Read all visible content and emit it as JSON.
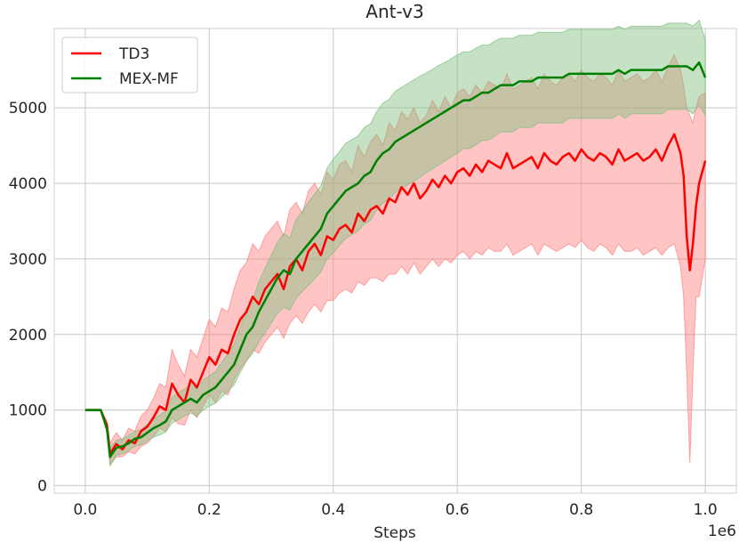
{
  "chart_data": {
    "type": "line",
    "title": "Ant-v3",
    "xlabel": "Steps",
    "ylabel": "",
    "x_scale_label": "1e6",
    "xlim": [
      -0.05,
      1.05
    ],
    "ylim": [
      -100,
      6050
    ],
    "xticks": [
      0.0,
      0.2,
      0.4,
      0.6,
      0.8,
      1.0
    ],
    "xtick_labels": [
      "0.0",
      "0.2",
      "0.4",
      "0.6",
      "0.8",
      "1.0"
    ],
    "yticks": [
      0,
      1000,
      2000,
      3000,
      4000,
      5000
    ],
    "ytick_labels": [
      "0",
      "1000",
      "2000",
      "3000",
      "4000",
      "5000"
    ],
    "grid": true,
    "legend_position": "top-left",
    "series": [
      {
        "name": "TD3",
        "color": "#ff0000",
        "band_color": "#ff7f7f",
        "x": [
          0.0,
          0.025,
          0.035,
          0.04,
          0.05,
          0.06,
          0.07,
          0.08,
          0.09,
          0.1,
          0.11,
          0.12,
          0.13,
          0.14,
          0.15,
          0.16,
          0.17,
          0.18,
          0.19,
          0.2,
          0.21,
          0.22,
          0.23,
          0.24,
          0.25,
          0.26,
          0.27,
          0.28,
          0.29,
          0.3,
          0.31,
          0.32,
          0.33,
          0.34,
          0.35,
          0.36,
          0.37,
          0.38,
          0.39,
          0.4,
          0.41,
          0.42,
          0.43,
          0.44,
          0.45,
          0.46,
          0.47,
          0.48,
          0.49,
          0.5,
          0.51,
          0.52,
          0.53,
          0.54,
          0.55,
          0.56,
          0.57,
          0.58,
          0.59,
          0.6,
          0.61,
          0.62,
          0.63,
          0.64,
          0.65,
          0.66,
          0.67,
          0.68,
          0.69,
          0.7,
          0.71,
          0.72,
          0.73,
          0.74,
          0.75,
          0.76,
          0.77,
          0.78,
          0.79,
          0.8,
          0.81,
          0.82,
          0.83,
          0.84,
          0.85,
          0.86,
          0.87,
          0.88,
          0.89,
          0.9,
          0.91,
          0.92,
          0.93,
          0.94,
          0.95,
          0.96,
          0.965,
          0.97,
          0.975,
          0.98,
          0.985,
          0.99,
          1.0
        ],
        "y": [
          1000,
          1000,
          800,
          420,
          550,
          480,
          600,
          560,
          720,
          780,
          900,
          1050,
          1000,
          1350,
          1200,
          1100,
          1400,
          1300,
          1500,
          1700,
          1600,
          1800,
          1750,
          2000,
          2200,
          2300,
          2500,
          2400,
          2600,
          2700,
          2800,
          2600,
          2900,
          3000,
          2850,
          3100,
          3200,
          3050,
          3300,
          3250,
          3400,
          3450,
          3350,
          3600,
          3500,
          3650,
          3700,
          3600,
          3800,
          3750,
          3950,
          3850,
          4000,
          3800,
          3900,
          4050,
          3950,
          4100,
          4000,
          4150,
          4200,
          4100,
          4250,
          4150,
          4300,
          4250,
          4200,
          4400,
          4200,
          4250,
          4300,
          4350,
          4200,
          4400,
          4300,
          4250,
          4350,
          4400,
          4300,
          4450,
          4350,
          4300,
          4400,
          4350,
          4250,
          4450,
          4300,
          4350,
          4400,
          4300,
          4350,
          4450,
          4300,
          4500,
          4650,
          4400,
          4100,
          3300,
          2850,
          3200,
          3700,
          4000,
          4300
        ],
        "lower": [
          1000,
          1000,
          750,
          280,
          380,
          380,
          450,
          420,
          520,
          560,
          650,
          760,
          720,
          900,
          820,
          800,
          1000,
          900,
          1050,
          1200,
          1100,
          1250,
          1200,
          1400,
          1550,
          1650,
          1800,
          1750,
          1900,
          2000,
          2100,
          1950,
          2150,
          2250,
          2150,
          2300,
          2400,
          2300,
          2450,
          2450,
          2550,
          2600,
          2550,
          2700,
          2650,
          2750,
          2750,
          2700,
          2800,
          2800,
          2900,
          2800,
          2950,
          2800,
          2900,
          3000,
          2900,
          3000,
          2950,
          3050,
          3100,
          3000,
          3100,
          3050,
          3150,
          3100,
          3100,
          3200,
          3050,
          3100,
          3150,
          3200,
          3050,
          3200,
          3150,
          3100,
          3150,
          3200,
          3150,
          3250,
          3150,
          3100,
          3200,
          3150,
          3050,
          3200,
          3100,
          3100,
          3150,
          3050,
          3100,
          3150,
          3050,
          3150,
          3200,
          2900,
          2500,
          1500,
          300,
          1500,
          2500,
          2500,
          3000
        ],
        "upper": [
          1000,
          1000,
          850,
          560,
          700,
          600,
          760,
          720,
          920,
          1000,
          1150,
          1350,
          1300,
          1800,
          1600,
          1450,
          1800,
          1700,
          1950,
          2200,
          2100,
          2350,
          2300,
          2600,
          2850,
          2950,
          3200,
          3100,
          3300,
          3400,
          3500,
          3300,
          3650,
          3750,
          3600,
          3900,
          4000,
          3850,
          4150,
          4050,
          4250,
          4300,
          4150,
          4500,
          4350,
          4550,
          4650,
          4500,
          4800,
          4700,
          4950,
          4850,
          5000,
          4800,
          4900,
          5100,
          4950,
          5150,
          5000,
          5200,
          5250,
          5150,
          5300,
          5200,
          5350,
          5300,
          5250,
          5450,
          5250,
          5300,
          5350,
          5400,
          5250,
          5450,
          5350,
          5300,
          5400,
          5450,
          5350,
          5500,
          5400,
          5350,
          5450,
          5400,
          5300,
          5500,
          5350,
          5400,
          5450,
          5350,
          5400,
          5500,
          5350,
          5550,
          5700,
          5500,
          5300,
          5000,
          4900,
          4800,
          5000,
          5150,
          5200
        ]
      },
      {
        "name": "MEX-MF",
        "color": "#008000",
        "band_color": "#7fbf7f",
        "x": [
          0.0,
          0.025,
          0.035,
          0.04,
          0.05,
          0.06,
          0.07,
          0.08,
          0.09,
          0.1,
          0.11,
          0.12,
          0.13,
          0.14,
          0.15,
          0.16,
          0.17,
          0.18,
          0.19,
          0.2,
          0.21,
          0.22,
          0.23,
          0.24,
          0.25,
          0.26,
          0.27,
          0.28,
          0.29,
          0.3,
          0.31,
          0.32,
          0.33,
          0.34,
          0.35,
          0.36,
          0.37,
          0.38,
          0.39,
          0.4,
          0.41,
          0.42,
          0.43,
          0.44,
          0.45,
          0.46,
          0.47,
          0.48,
          0.49,
          0.5,
          0.51,
          0.52,
          0.53,
          0.54,
          0.55,
          0.56,
          0.57,
          0.58,
          0.59,
          0.6,
          0.61,
          0.62,
          0.63,
          0.64,
          0.65,
          0.66,
          0.67,
          0.68,
          0.69,
          0.7,
          0.71,
          0.72,
          0.73,
          0.74,
          0.75,
          0.76,
          0.77,
          0.78,
          0.79,
          0.8,
          0.81,
          0.82,
          0.83,
          0.84,
          0.85,
          0.86,
          0.87,
          0.88,
          0.89,
          0.9,
          0.91,
          0.92,
          0.93,
          0.94,
          0.95,
          0.96,
          0.97,
          0.98,
          0.99,
          1.0
        ],
        "y": [
          1000,
          1000,
          750,
          380,
          500,
          520,
          560,
          620,
          640,
          700,
          760,
          800,
          850,
          1000,
          1050,
          1100,
          1150,
          1100,
          1200,
          1250,
          1300,
          1400,
          1500,
          1600,
          1800,
          2000,
          2100,
          2300,
          2450,
          2600,
          2750,
          2850,
          2800,
          3000,
          3100,
          3200,
          3300,
          3400,
          3600,
          3700,
          3800,
          3900,
          3950,
          4000,
          4100,
          4150,
          4300,
          4400,
          4450,
          4550,
          4600,
          4650,
          4700,
          4750,
          4800,
          4850,
          4900,
          4950,
          5000,
          5050,
          5100,
          5100,
          5150,
          5200,
          5200,
          5250,
          5300,
          5300,
          5300,
          5350,
          5350,
          5350,
          5400,
          5400,
          5400,
          5400,
          5400,
          5450,
          5450,
          5450,
          5450,
          5450,
          5450,
          5450,
          5450,
          5500,
          5450,
          5500,
          5500,
          5500,
          5500,
          5500,
          5500,
          5550,
          5550,
          5550,
          5550,
          5500,
          5600,
          5400
        ],
        "lower": [
          1000,
          1000,
          700,
          260,
          400,
          420,
          460,
          520,
          540,
          590,
          640,
          670,
          710,
          830,
          870,
          920,
          960,
          920,
          1000,
          1050,
          1090,
          1170,
          1250,
          1330,
          1500,
          1650,
          1750,
          1900,
          2020,
          2150,
          2280,
          2360,
          2320,
          2480,
          2570,
          2650,
          2740,
          2830,
          3000,
          3080,
          3180,
          3270,
          3320,
          3370,
          3460,
          3510,
          3650,
          3740,
          3790,
          3880,
          3930,
          3980,
          4030,
          4080,
          4140,
          4190,
          4240,
          4300,
          4350,
          4400,
          4460,
          4460,
          4510,
          4570,
          4570,
          4620,
          4680,
          4680,
          4680,
          4740,
          4740,
          4740,
          4800,
          4800,
          4800,
          4800,
          4800,
          4860,
          4860,
          4860,
          4860,
          4860,
          4860,
          4860,
          4860,
          4920,
          4860,
          4920,
          4920,
          4920,
          4920,
          4920,
          4920,
          4980,
          4980,
          4980,
          4980,
          4920,
          5040,
          4900
        ],
        "upper": [
          1000,
          1000,
          800,
          500,
          600,
          620,
          660,
          720,
          740,
          810,
          880,
          930,
          990,
          1170,
          1230,
          1280,
          1340,
          1280,
          1400,
          1450,
          1510,
          1630,
          1750,
          1870,
          2100,
          2350,
          2450,
          2700,
          2880,
          3050,
          3220,
          3340,
          3280,
          3520,
          3630,
          3750,
          3860,
          3970,
          4200,
          4320,
          4420,
          4530,
          4580,
          4630,
          4740,
          4790,
          4950,
          5060,
          5110,
          5220,
          5270,
          5320,
          5370,
          5420,
          5460,
          5510,
          5560,
          5600,
          5650,
          5700,
          5740,
          5740,
          5790,
          5830,
          5830,
          5880,
          5920,
          5920,
          5920,
          5960,
          5960,
          5960,
          6000,
          6000,
          6000,
          6000,
          6000,
          6040,
          6040,
          6040,
          6040,
          6040,
          6040,
          6040,
          6040,
          6080,
          6040,
          6080,
          6080,
          6080,
          6080,
          6080,
          6080,
          6120,
          6120,
          6120,
          6120,
          6080,
          6160,
          5900
        ]
      }
    ]
  }
}
